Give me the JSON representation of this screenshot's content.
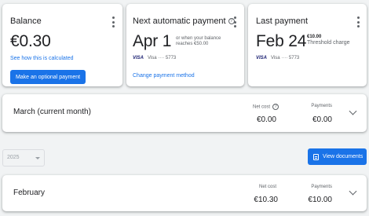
{
  "balance": {
    "title": "Balance",
    "amount": "€0.30",
    "how_link": "See how this is calculated",
    "pay_button": "Make an optional payment"
  },
  "next_payment": {
    "title": "Next automatic payment",
    "date": "Apr 1",
    "note_line1": "or when your balance",
    "note_line2": "reaches €50.00",
    "card_brand": "VISA",
    "card_label": "Visa ···· 5773",
    "change_link": "Change payment method"
  },
  "last_payment": {
    "title": "Last payment",
    "date": "Feb 24",
    "amount": "€10.00",
    "description": "Threshold charge",
    "card_brand": "VISA",
    "card_label": "Visa ···· 5773"
  },
  "current_month": {
    "label": "March (current month)",
    "net_cost_label": "Net cost",
    "net_cost_value": "€0.00",
    "payments_label": "Payments",
    "payments_value": "€0.00"
  },
  "filter": {
    "year": "2025",
    "view_documents": "View documents"
  },
  "february": {
    "label": "February",
    "net_cost_label": "Net cost",
    "net_cost_value": "€10.30",
    "payments_label": "Payments",
    "payments_value": "€10.00"
  }
}
